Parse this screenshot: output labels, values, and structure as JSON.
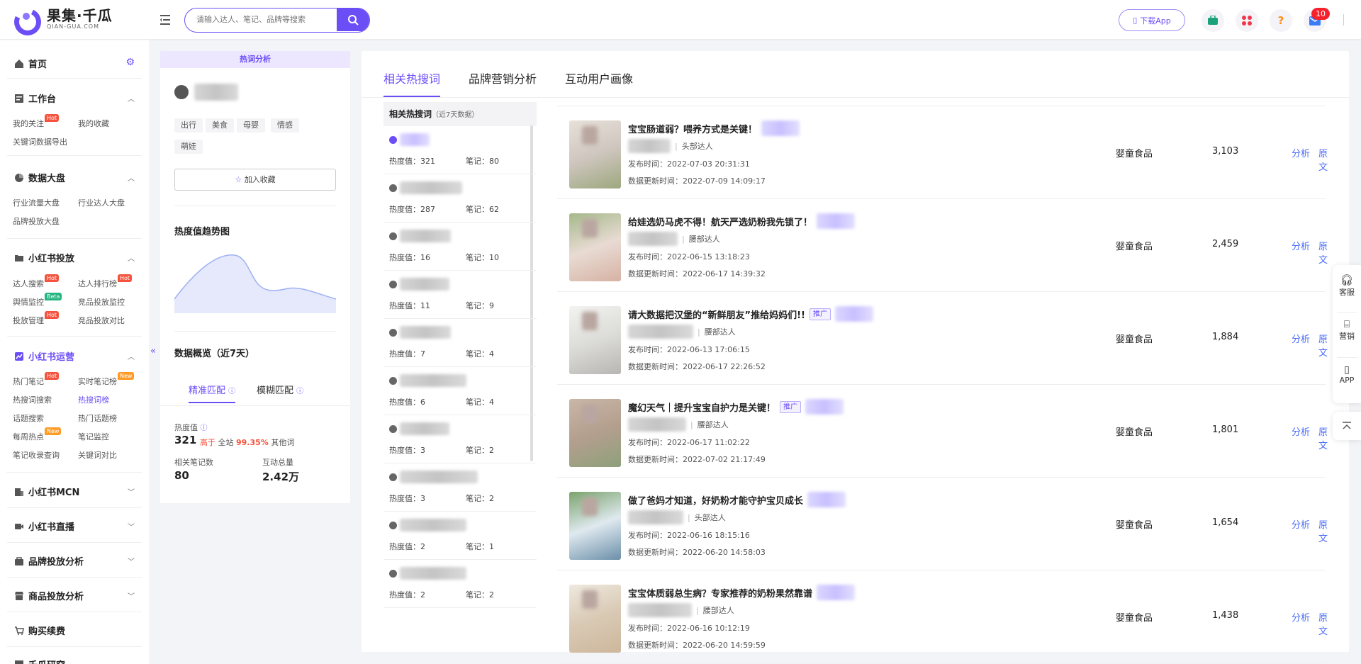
{
  "header": {
    "logo_cn": "果集·千瓜",
    "logo_en": "QIAN-GUA.COM",
    "search_placeholder": "请输入达人、笔记、品牌等搜索",
    "download_label": "下载App",
    "message_count": "10"
  },
  "sidebar": {
    "home": "首页",
    "workbench": "工作台",
    "my_follow": "我的关注",
    "my_collect": "我的收藏",
    "keyword_export": "关键词数据导出",
    "dashboard": "数据大盘",
    "industry_flow": "行业流量大盘",
    "industry_kol": "行业达人大盘",
    "brand_ads": "品牌投放大盘",
    "xhs_ads": "小红书投放",
    "kol_search": "达人搜索",
    "kol_rank": "达人排行榜",
    "sentiment": "舆情监控",
    "competitor_monitor": "竞品投放监控",
    "ads_manage": "投放管理",
    "competitor_compare": "竞品投放对比",
    "xhs_ops": "小红书运营",
    "hot_notes": "热门笔记",
    "realtime_rank": "实时笔记榜",
    "hot_search": "热搜词搜索",
    "hot_search_rank": "热搜词榜",
    "topic_search": "话题搜索",
    "hot_topic_rank": "热门话题榜",
    "weekly_hot": "每周热点",
    "note_monitor": "笔记监控",
    "note_record": "笔记收录查询",
    "keyword_compare": "关键词对比",
    "xhs_mcn": "小红书MCN",
    "xhs_live": "小红书直播",
    "brand_analysis": "品牌投放分析",
    "product_analysis": "商品投放分析",
    "purchase": "购买续费",
    "research": "千瓜研究",
    "tag_hot": "Hot",
    "tag_new": "New",
    "tag_beta": "Beta"
  },
  "left_panel": {
    "tab": "热词分析",
    "tags": [
      "出行",
      "美食",
      "母婴",
      "情感",
      "萌娃"
    ],
    "fav_button": "加入收藏",
    "trend_title": "热度值趋势图",
    "overview_title": "数据概览（近7天）",
    "match_exact": "精准匹配",
    "match_fuzzy": "模糊匹配",
    "heat_label": "热度值",
    "heat_value": "321",
    "higher_than": "高于",
    "site_wide": "全站",
    "percent": "99.35%",
    "other_words": "其他词",
    "notes_label": "相关笔记数",
    "notes_value": "80",
    "interaction_label": "互动总量",
    "interaction_value": "2.42万"
  },
  "main": {
    "tabs": [
      "相关热搜词",
      "品牌营销分析",
      "互动用户画像"
    ],
    "kwlist_title": "相关热搜词",
    "kwlist_sub": "（近7天数据）",
    "heat_prefix": "热度值：",
    "notes_prefix": "笔记：",
    "keywords": [
      {
        "heat": "321",
        "notes": "80"
      },
      {
        "heat": "287",
        "notes": "62"
      },
      {
        "heat": "16",
        "notes": "10"
      },
      {
        "heat": "11",
        "notes": "9"
      },
      {
        "heat": "7",
        "notes": "4"
      },
      {
        "heat": "6",
        "notes": "4"
      },
      {
        "heat": "3",
        "notes": "2"
      },
      {
        "heat": "3",
        "notes": "2"
      },
      {
        "heat": "2",
        "notes": "1"
      },
      {
        "heat": "2",
        "notes": "2"
      }
    ],
    "publish_prefix": "发布时间：",
    "update_prefix": "数据更新时间：",
    "analyze_label": "分析",
    "original_label": "原文",
    "promo_label": "推广",
    "notes": [
      {
        "title": "宝宝肠道弱？喂养方式是关键！",
        "level": "头部达人",
        "publish": "2022-07-03 20:31:31",
        "update": "2022-07-09 14:09:17",
        "category": "婴童食品",
        "value": "3,103",
        "promo": false
      },
      {
        "title": "给娃选奶马虎不得！航天严选奶粉我先锁了！",
        "level": "腰部达人",
        "publish": "2022-06-15 13:18:23",
        "update": "2022-06-17 14:39:32",
        "category": "婴童食品",
        "value": "2,459",
        "promo": false
      },
      {
        "title": "请大数据把汉堡的“新鲜朋友”推给妈妈们!!",
        "level": "腰部达人",
        "publish": "2022-06-13 17:06:15",
        "update": "2022-06-17 22:26:52",
        "category": "婴童食品",
        "value": "1,884",
        "promo": true
      },
      {
        "title": "魔幻天气｜提升宝宝自护力是关键！",
        "level": "腰部达人",
        "publish": "2022-06-17 11:02:22",
        "update": "2022-07-02 21:17:49",
        "category": "婴童食品",
        "value": "1,801",
        "promo": true
      },
      {
        "title": "做了爸妈才知道，好奶粉才能守护宝贝成长",
        "level": "头部达人",
        "publish": "2022-06-16 18:15:16",
        "update": "2022-06-20 14:58:03",
        "category": "婴童食品",
        "value": "1,654",
        "promo": false
      },
      {
        "title": "宝宝体质弱总生病？专家推荐的奶粉果然靠谱",
        "level": "腰部达人",
        "publish": "2022-06-16 10:12:19",
        "update": "2022-06-20 14:59:59",
        "category": "婴童食品",
        "value": "1,438",
        "promo": false
      }
    ]
  },
  "float": {
    "service": "客服",
    "marketing": "营销",
    "app": "APP"
  },
  "colors": {
    "accent": "#6c4ef7",
    "link": "#4a6cf7",
    "hot": "#f5533d"
  }
}
